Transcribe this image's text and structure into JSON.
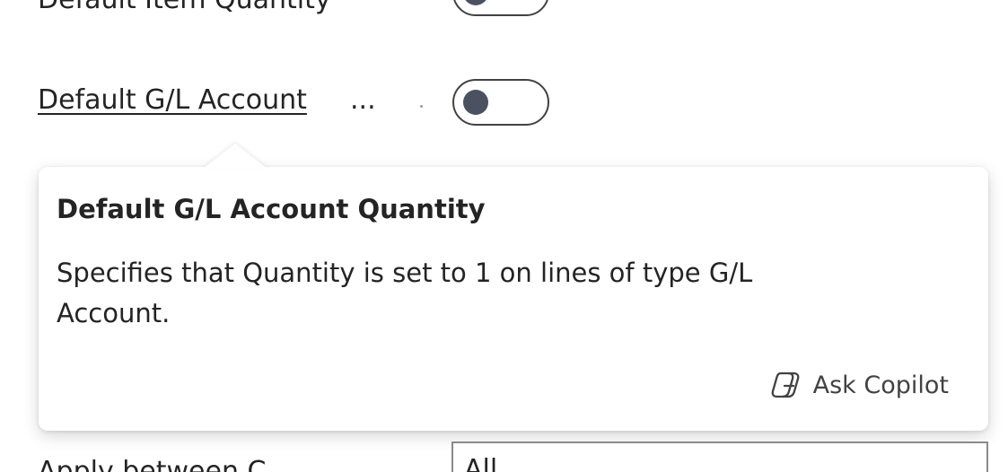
{
  "fields": {
    "item_quantity": {
      "label": "Default Item Quantity",
      "enabled": false
    },
    "gl_account_quantity": {
      "label": "Default G/L Account",
      "ellipsis": "...",
      "enabled": false
    },
    "apply_between": {
      "label": "Apply between C",
      "value": "All"
    }
  },
  "callout": {
    "title": "Default G/L Account Quantity",
    "body": "Specifies that Quantity is set to 1 on lines of type G/L Account.",
    "copilot_label": "Ask Copilot",
    "copilot_icon": "copilot-icon"
  },
  "colors": {
    "text": "#242424",
    "toggle_knob": "#4a5160",
    "toggle_border": "#424242"
  }
}
